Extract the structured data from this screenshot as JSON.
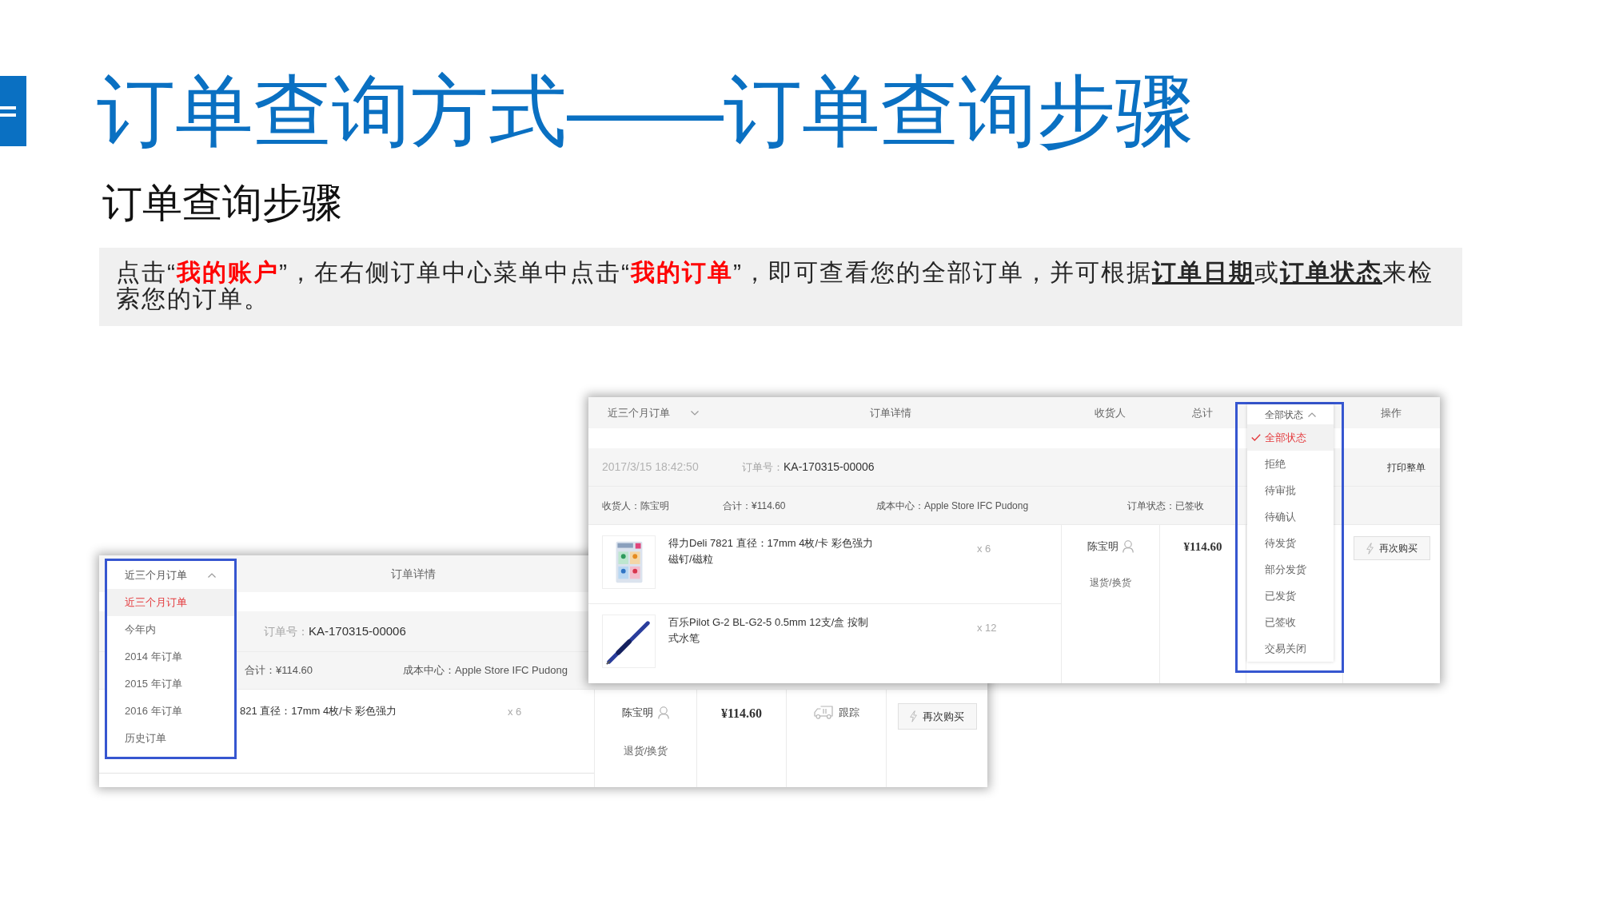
{
  "slide": {
    "title": "订单查询方式——订单查询步骤",
    "subtitle": "订单查询步骤",
    "instruction": [
      {
        "kind": "plain",
        "text": "点击“"
      },
      {
        "kind": "menu_name",
        "text": "我的账户"
      },
      {
        "kind": "plain",
        "text": "”，在右侧订单中心菜单中点击“"
      },
      {
        "kind": "menu_name",
        "text": "我的订单"
      },
      {
        "kind": "plain",
        "text": "”，即可查看您的全部订单，并可根据"
      },
      {
        "kind": "filter_name",
        "text": "订单日期"
      },
      {
        "kind": "plain",
        "text": "或"
      },
      {
        "kind": "filter_name",
        "text": "订单状态"
      },
      {
        "kind": "plain",
        "text": "来检索您的订单。"
      }
    ]
  },
  "status_view": {
    "header": {
      "period_dropdown": {
        "label": "近三个月订单",
        "expanded": false
      },
      "columns": [
        "订单详情",
        "收货人",
        "总计"
      ],
      "status_dropdown": {
        "label": "全部状态",
        "expanded": true
      },
      "actions_column": "操作"
    },
    "status_options": [
      {
        "label": "全部状态",
        "selected": true
      },
      {
        "label": "拒绝",
        "selected": false
      },
      {
        "label": "待审批",
        "selected": false
      },
      {
        "label": "待确认",
        "selected": false
      },
      {
        "label": "待发货",
        "selected": false
      },
      {
        "label": "部分发货",
        "selected": false
      },
      {
        "label": "已发货",
        "selected": false
      },
      {
        "label": "已签收",
        "selected": false
      },
      {
        "label": "交易关闭",
        "selected": false
      }
    ],
    "order": {
      "date": "2017/3/15 18:42:50",
      "number_label": "订单号：",
      "number": "KA-170315-00006",
      "print_link": "打印整单",
      "consignee_info": "收货人：陈宝明",
      "total": "合计：¥114.60",
      "cost_center": "成本中心：Apple Store IFC Pudong",
      "status": "订单状态：已签收"
    },
    "items": [
      {
        "name": "得力Deli 7821 直径：17mm 4枚/卡 彩色强力磁钉/磁粒",
        "quantity": "x 6"
      },
      {
        "name": "百乐Pilot G-2 BL-G2-5 0.5mm 12支/盒 按制式水笔",
        "quantity": "x 12"
      }
    ],
    "consignee": "陈宝明",
    "return_link": "退货/换货",
    "amount": "¥114.60",
    "rebuy_button": "再次购买"
  },
  "period_view": {
    "header": {
      "period_dropdown": {
        "label": "近三个月订单",
        "expanded": true
      },
      "detail_column": "订单详情"
    },
    "period_options": [
      {
        "label": "近三个月订单",
        "selected": true
      },
      {
        "label": "今年内",
        "selected": false
      },
      {
        "label": "2014 年订单",
        "selected": false
      },
      {
        "label": "2015 年订单",
        "selected": false
      },
      {
        "label": "2016 年订单",
        "selected": false
      },
      {
        "label": "历史订单",
        "selected": false
      }
    ],
    "order": {
      "number_label": "订单号：",
      "number": "KA-170315-00006",
      "total": "合计：¥114.60",
      "cost_center": "成本中心：Apple Store IFC Pudong"
    },
    "item": {
      "name": "821 直径：17mm 4枚/卡 彩色强力",
      "quantity": "x 6"
    },
    "consignee": "陈宝明",
    "return_link": "退货/换货",
    "amount": "¥114.60",
    "track_link": "跟踪",
    "rebuy_button": "再次购买"
  }
}
